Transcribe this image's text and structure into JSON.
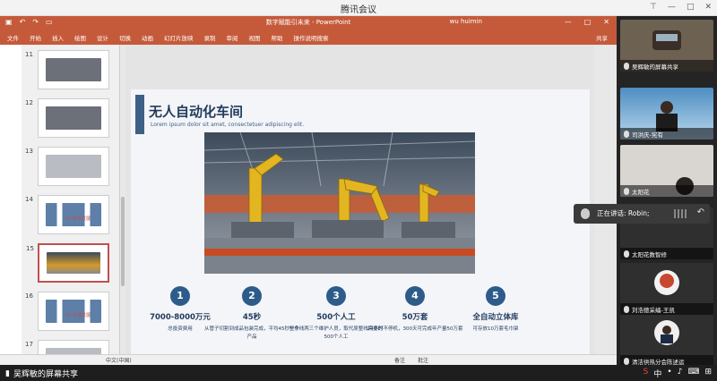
{
  "window_title": "腾讯会议",
  "ppt": {
    "doc_title": "数字赋能引未来 - PowerPoint",
    "user": "wu huimin",
    "ribbon": [
      "文件",
      "开始",
      "插入",
      "绘图",
      "设计",
      "切换",
      "动画",
      "幻灯片放映",
      "录制",
      "审阅",
      "视图",
      "帮助",
      "操作说明搜索"
    ],
    "share_label": "共享",
    "thumb_numbers": [
      "11",
      "12",
      "13",
      "14",
      "15",
      "16",
      "17"
    ],
    "thumb_captions": [
      "",
      "",
      "",
      "02 技术发展",
      "",
      "03 市场发展",
      ""
    ],
    "status_left": "中文(中国)",
    "status_right": [
      "备注",
      "批注"
    ]
  },
  "slide": {
    "title": "无人自动化车间",
    "subtitle": "Lorem ipsum dolor sit amet, consectetuer adipiscing elit.",
    "features": [
      {
        "num": "1",
        "title": "7000-8000万元",
        "desc": "总投资费用"
      },
      {
        "num": "2",
        "title": "45秒",
        "desc": "从管子切割到成品包装完成，平均45秒一个产品"
      },
      {
        "num": "3",
        "title": "500个人工",
        "desc": "整条线两三个维护人员，取代原整线需要的500个人工"
      },
      {
        "num": "4",
        "title": "50万套",
        "desc": "24小时不停机，300天可完成年产量50万套"
      },
      {
        "num": "5",
        "title": "全自动立体库",
        "desc": "可存放10万套毛巾架"
      }
    ]
  },
  "participants": [
    {
      "name": "吴辉敏的屏幕共享"
    },
    {
      "name": "司洪庆-宪有"
    },
    {
      "name": "太阳花"
    },
    {
      "name": "太阳花数智修"
    },
    {
      "name": "刘浩德采编-王凯"
    },
    {
      "name": "清洁供热分会陈述运"
    }
  ],
  "speaking": "正在讲话: Robin;",
  "bottom_share": "吴辉敏的屏幕共享",
  "colors": {
    "accent": "#c55a3a",
    "navy": "#2e5c8a"
  }
}
